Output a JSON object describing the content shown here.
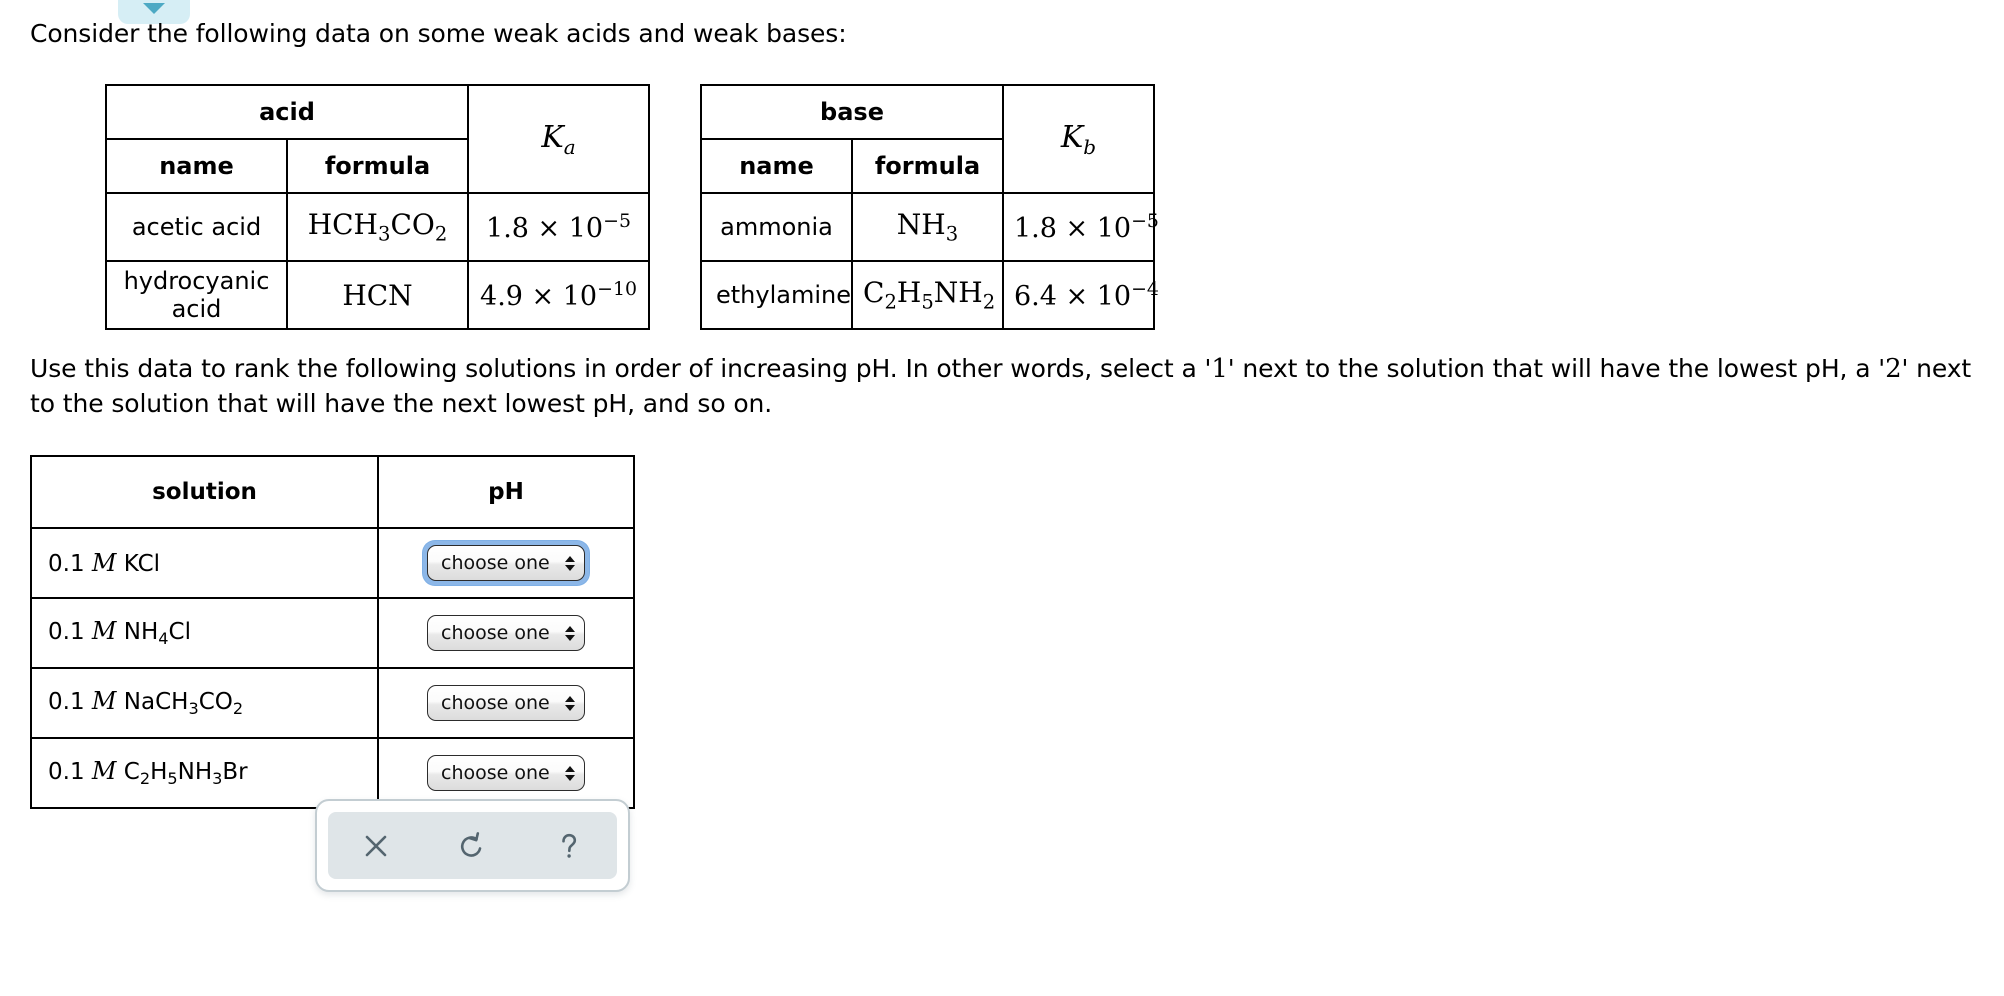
{
  "top_badge": {
    "icon": "chevron-down-icon",
    "color": "#d6eef5",
    "arrow_color": "#4da9c4"
  },
  "intro": "Consider the following data on some weak acids and weak bases:",
  "instructions": {
    "part1": "Use this data to rank the following solutions in order of increasing pH. In other words, select a '",
    "num1": "1",
    "part2": "' next to the solution that will have the lowest pH, a '",
    "num2": "2",
    "part3": "' next to the solution that will have the next lowest pH, and so on."
  },
  "acid_table": {
    "group_header": "acid",
    "constant_symbol": "K",
    "constant_subscript": "a",
    "columns": [
      "name",
      "formula"
    ],
    "rows": [
      {
        "name": "acetic acid",
        "formula_parts": [
          {
            "t": "HCH",
            "s": "normal"
          },
          {
            "t": "3",
            "s": "sub"
          },
          {
            "t": "CO",
            "s": "normal"
          },
          {
            "t": "2",
            "s": "sub"
          }
        ],
        "value_mantissa": "1.8 × 10",
        "value_exponent": "−5"
      },
      {
        "name": "hydrocyanic acid",
        "formula_parts": [
          {
            "t": "HCN",
            "s": "normal"
          }
        ],
        "value_mantissa": "4.9 × 10",
        "value_exponent": "−10"
      }
    ]
  },
  "base_table": {
    "group_header": "base",
    "constant_symbol": "K",
    "constant_subscript": "b",
    "columns": [
      "name",
      "formula"
    ],
    "rows": [
      {
        "name": "ammonia",
        "formula_parts": [
          {
            "t": "NH",
            "s": "normal"
          },
          {
            "t": "3",
            "s": "sub"
          }
        ],
        "value_mantissa": "1.8 × 10",
        "value_exponent": "−5"
      },
      {
        "name": "ethylamine",
        "formula_parts": [
          {
            "t": "C",
            "s": "normal"
          },
          {
            "t": "2",
            "s": "sub"
          },
          {
            "t": "H",
            "s": "normal"
          },
          {
            "t": "5",
            "s": "sub"
          },
          {
            "t": "NH",
            "s": "normal"
          },
          {
            "t": "2",
            "s": "sub"
          }
        ],
        "value_mantissa": "6.4 × 10",
        "value_exponent": "−4"
      }
    ]
  },
  "solution_table": {
    "headers": [
      "solution",
      "pH"
    ],
    "select_placeholder": "choose one",
    "rows": [
      {
        "conc": "0.1 ",
        "unit": "M",
        "formula_parts": [
          {
            "t": " KCl",
            "s": "normal"
          }
        ],
        "ph_value": "choose one",
        "focused": true
      },
      {
        "conc": "0.1 ",
        "unit": "M",
        "formula_parts": [
          {
            "t": " NH",
            "s": "normal"
          },
          {
            "t": "4",
            "s": "sub"
          },
          {
            "t": "Cl",
            "s": "normal"
          }
        ],
        "ph_value": "choose one",
        "focused": false
      },
      {
        "conc": "0.1 ",
        "unit": "M",
        "formula_parts": [
          {
            "t": " NaCH",
            "s": "normal"
          },
          {
            "t": "3",
            "s": "sub"
          },
          {
            "t": "CO",
            "s": "normal"
          },
          {
            "t": "2",
            "s": "sub"
          }
        ],
        "ph_value": "choose one",
        "focused": false
      },
      {
        "conc": "0.1 ",
        "unit": "M",
        "formula_parts": [
          {
            "t": " C",
            "s": "normal"
          },
          {
            "t": "2",
            "s": "sub"
          },
          {
            "t": "H",
            "s": "normal"
          },
          {
            "t": "5",
            "s": "sub"
          },
          {
            "t": "NH",
            "s": "normal"
          },
          {
            "t": "3",
            "s": "sub"
          },
          {
            "t": "Br",
            "s": "normal"
          }
        ],
        "ph_value": "choose one",
        "focused": false
      }
    ]
  },
  "toolbar": {
    "buttons": [
      {
        "name": "close-icon",
        "label": "×"
      },
      {
        "name": "reset-icon",
        "label": "↺"
      },
      {
        "name": "help-icon",
        "label": "?"
      }
    ],
    "panel_color": "#dfe5e8",
    "icon_color": "#54656f"
  }
}
